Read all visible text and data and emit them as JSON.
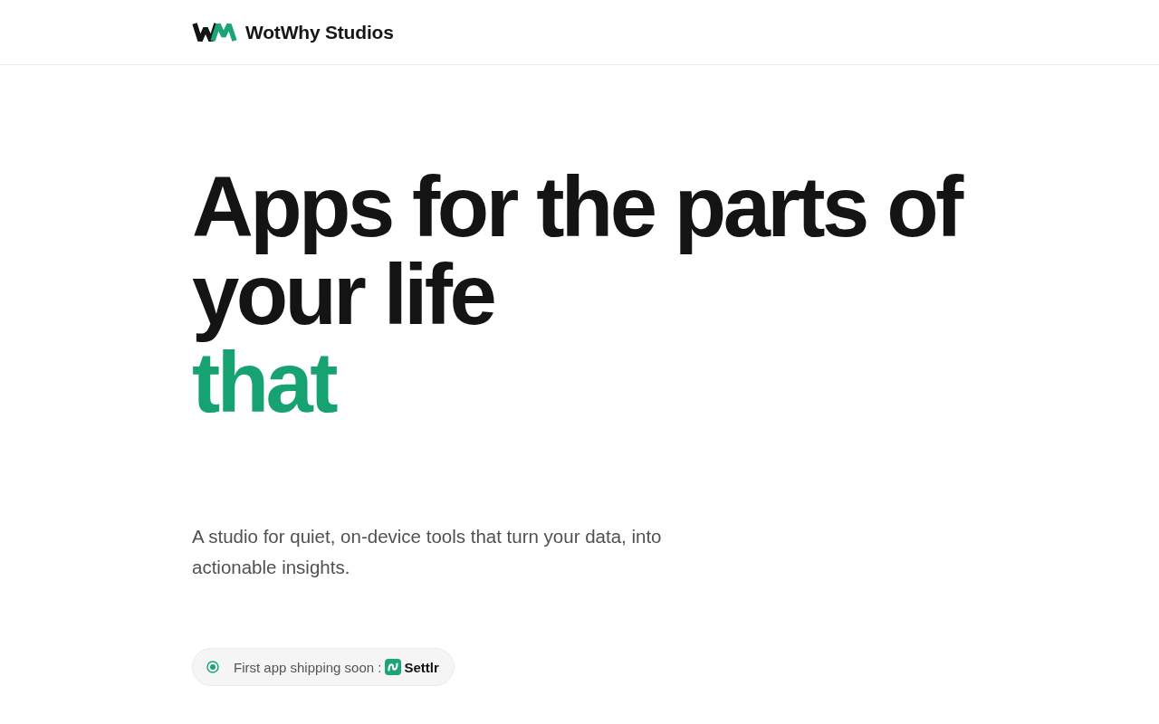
{
  "header": {
    "brand": "WotWhy Studios"
  },
  "hero": {
    "headline": "Apps for the parts of your life",
    "accent_word": "that",
    "tagline": "A studio for quiet, on-device tools that turn your data, into actionable insights."
  },
  "announcement": {
    "label": "First app shipping soon :",
    "app_name": "Settlr"
  }
}
